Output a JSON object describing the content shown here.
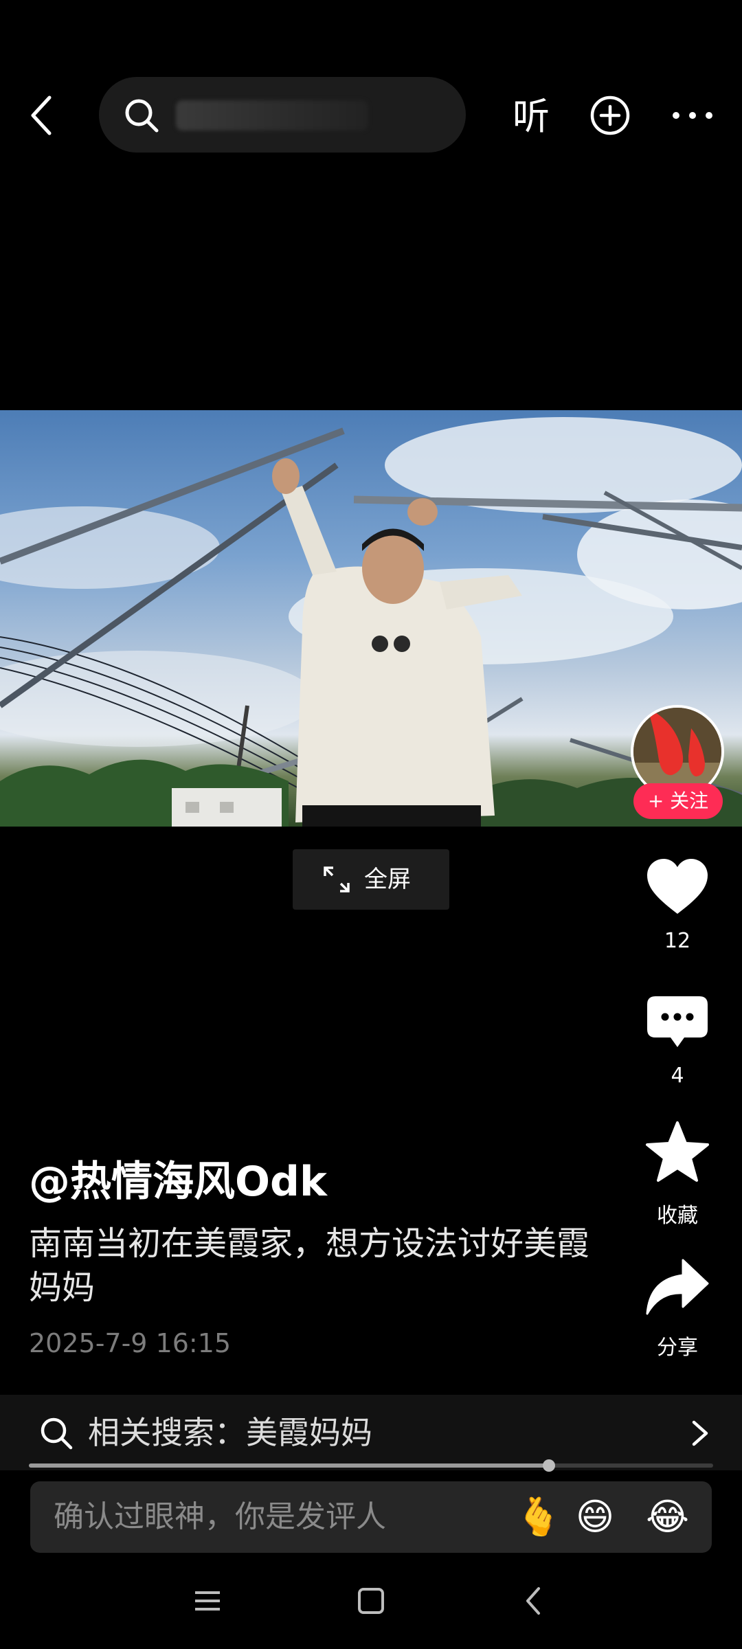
{
  "top_bar": {
    "listen_label": "听",
    "icons": [
      "back-icon",
      "search-icon",
      "add-circle-icon",
      "more-icon"
    ]
  },
  "video": {
    "follow_label": "+ 关注",
    "fullscreen_label": "全屏"
  },
  "actions": {
    "like_count": "12",
    "comment_count": "4",
    "favorite_label": "收藏",
    "share_label": "分享"
  },
  "post": {
    "author": "@热情海风Odk",
    "description": "南南当初在美霞家，想方设法讨好美霞妈妈",
    "date": "2025-7-9 16:15"
  },
  "related_search": {
    "text": "相关搜索：美霞妈妈"
  },
  "progress": {
    "fraction": 0.76
  },
  "comment_input": {
    "placeholder": "确认过眼神，你是发评人",
    "emojis": [
      "🫰",
      "😄",
      "😂"
    ]
  },
  "colors": {
    "follow": "#fe2c55",
    "background": "#000000"
  }
}
